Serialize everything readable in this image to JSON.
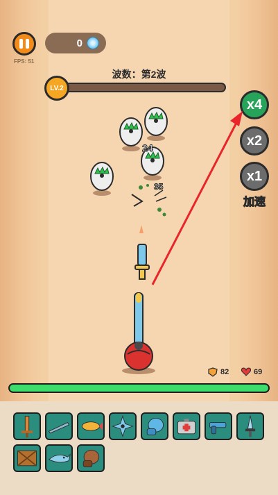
{
  "hud": {
    "fps_label": "FPS: 51",
    "coins": "0",
    "wave_title": "波数：第2波",
    "level": "LV.2",
    "xp_progress": 0.03
  },
  "speed": {
    "x4": "x4",
    "x2": "x2",
    "x1": "x1",
    "label": "加速"
  },
  "damage_numbers": [
    "24",
    "35"
  ],
  "player": {
    "shield": "82",
    "health": "69",
    "hp_fraction": 1.0
  },
  "inventory": {
    "items": [
      "wooden-sword-icon",
      "bat-icon",
      "fish-icon",
      "shuriken-icon",
      "boxing-glove-icon",
      "medkit-icon",
      "pistol-icon",
      "dagger-icon",
      "crate-icon",
      "shark-icon",
      "glove-icon"
    ]
  },
  "colors": {
    "accent": "#f28b1a",
    "speed_active": "#27a35a",
    "speed_inactive": "#6c6c6c",
    "hp_bar": "#3ddc6b",
    "slot_bg": "#2b8d7e",
    "arrow": "#e8252a"
  }
}
